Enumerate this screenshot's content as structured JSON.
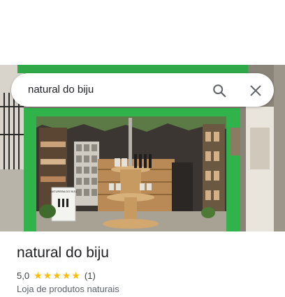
{
  "search": {
    "query": "natural do biju"
  },
  "place": {
    "name": "natural do biju",
    "rating": "5,0",
    "stars": [
      "★",
      "★",
      "★",
      "★",
      "★"
    ],
    "review_count": "(1)",
    "category": "Loja de produtos naturais"
  },
  "photo": {
    "sign_text": "NATUREBA DO BIJU"
  },
  "colors": {
    "storefront_green": "#2fb34a",
    "star": "#fbbc04"
  }
}
